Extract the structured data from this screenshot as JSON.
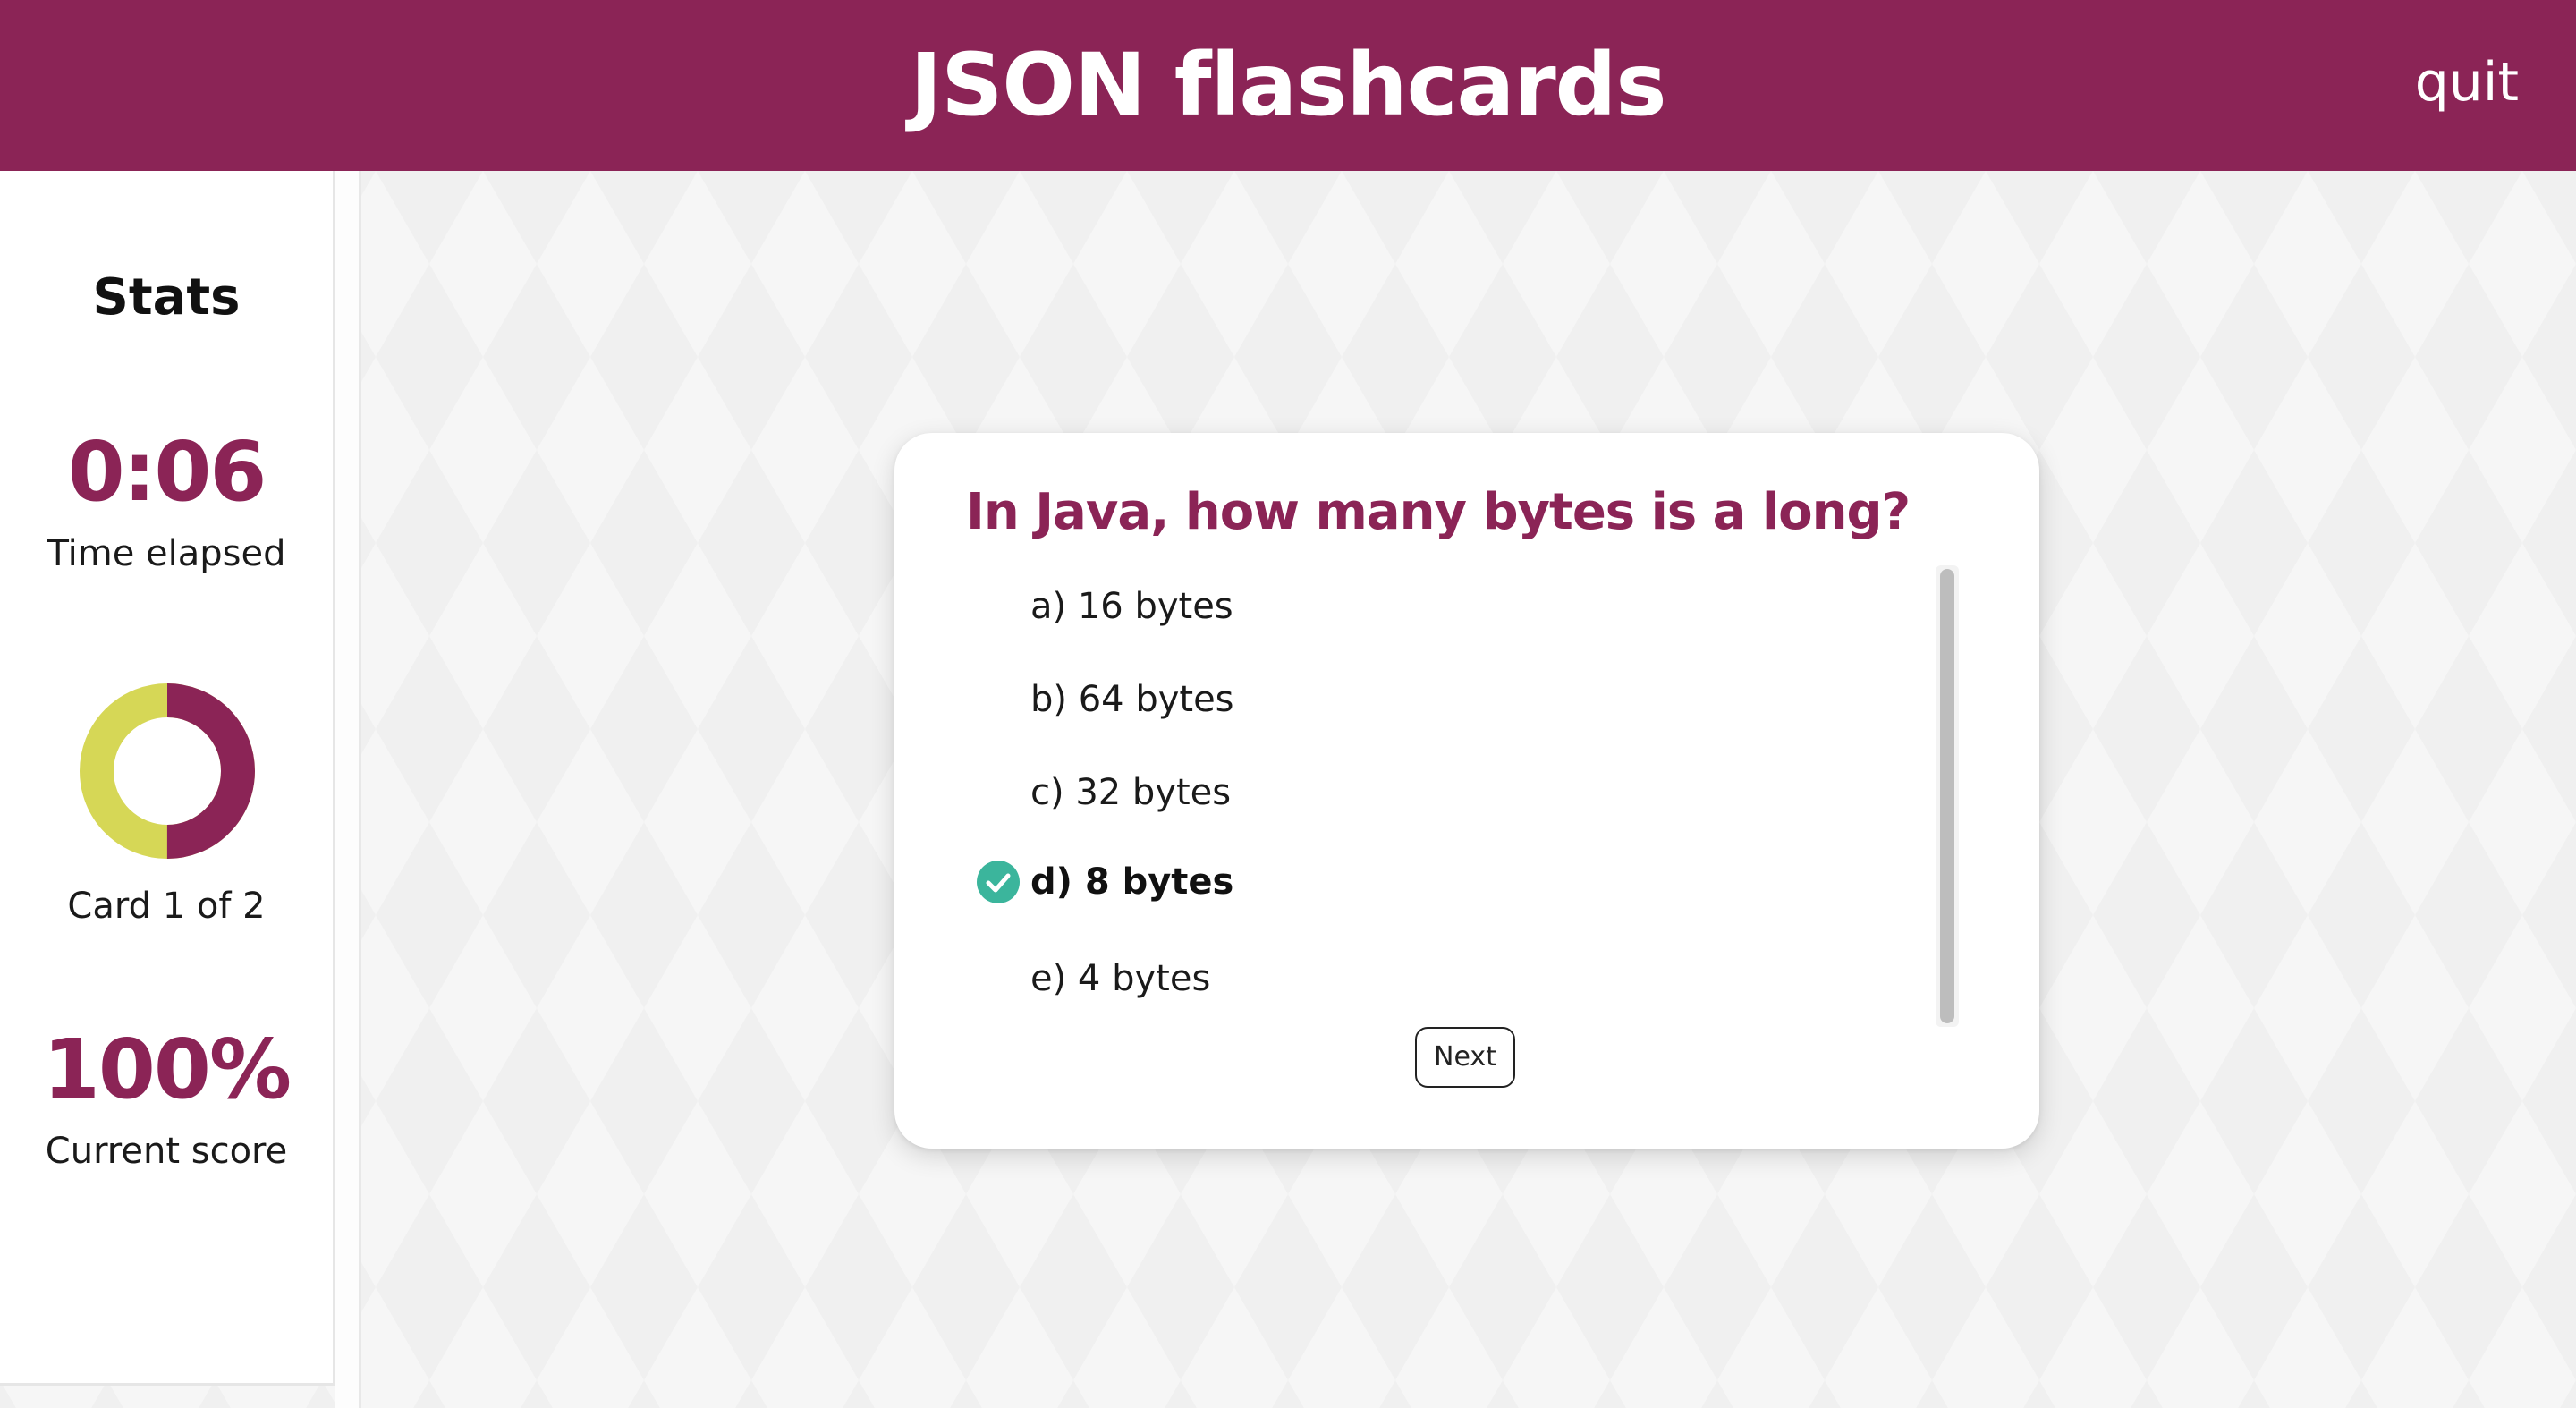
{
  "header": {
    "title": "JSON flashcards",
    "quit_label": "quit"
  },
  "sidebar": {
    "heading": "Stats",
    "time": {
      "value": "0:06",
      "label": "Time elapsed"
    },
    "progress": {
      "label": "Card 1 of 2",
      "fraction_complete": 0.5
    },
    "score": {
      "value": "100%",
      "label": "Current score"
    }
  },
  "card": {
    "question": "In Java, how many bytes is a long?",
    "answers": [
      {
        "label": "a) 16 bytes",
        "correct": false
      },
      {
        "label": "b) 64 bytes",
        "correct": false
      },
      {
        "label": "c) 32 bytes",
        "correct": false
      },
      {
        "label": "d) 8 bytes",
        "correct": true
      },
      {
        "label": "e) 4 bytes",
        "correct": false
      }
    ],
    "next_label": "Next",
    "correct_icon": "check-circle-icon"
  },
  "colors": {
    "brand": "#8b2456",
    "progress_remaining": "#d6d756",
    "correct": "#3bb59c"
  }
}
